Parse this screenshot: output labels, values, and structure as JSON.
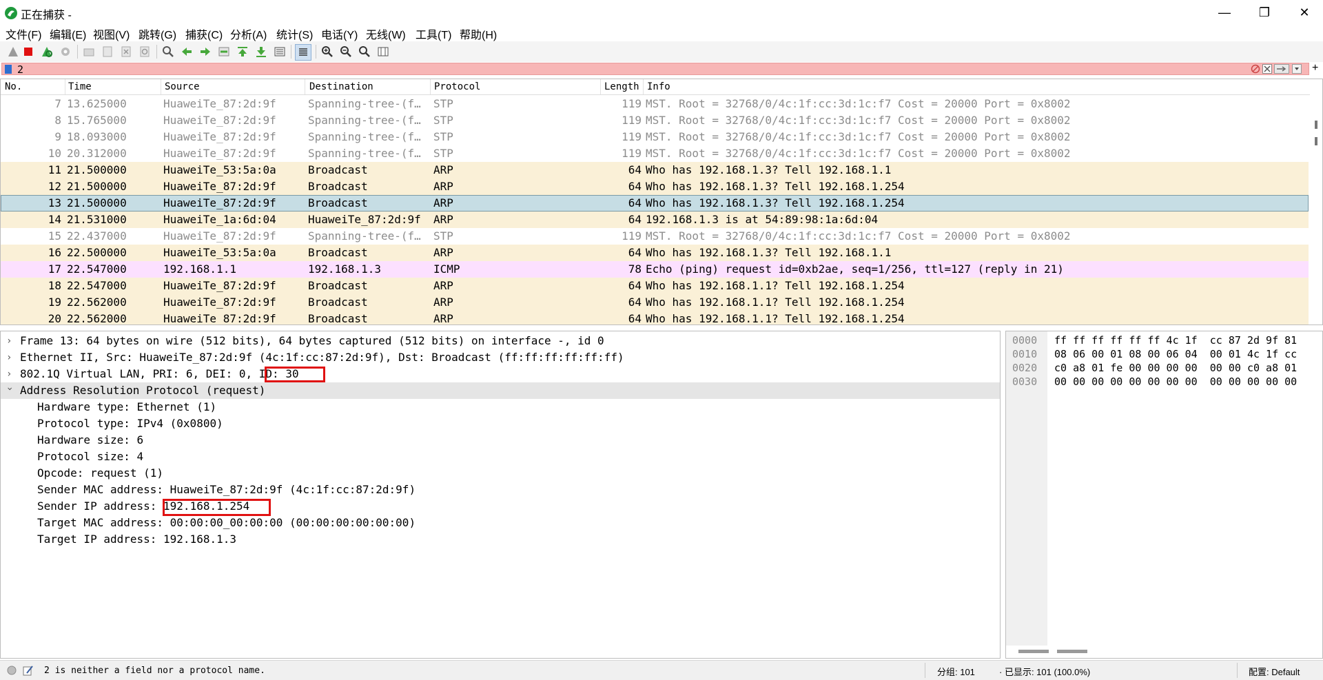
{
  "window": {
    "title": "正在捕获 -",
    "buttons": {
      "minimize": "—",
      "maximize": "❐",
      "close": "✕"
    }
  },
  "menu": [
    "文件(F)",
    "编辑(E)",
    "视图(V)",
    "跳转(G)",
    "捕获(C)",
    "分析(A)",
    "统计(S)",
    "电话(Y)",
    "无线(W)",
    "工具(T)",
    "帮助(H)"
  ],
  "toolbar_icons": [
    "shark-fin-start-icon",
    "stop-capture-icon",
    "restart-capture-icon",
    "capture-options-icon",
    "open-file-icon",
    "save-file-icon",
    "close-file-icon",
    "reload-file-icon",
    "find-packet-icon",
    "go-back-icon",
    "go-forward-icon",
    "go-to-packet-icon",
    "go-first-icon",
    "go-last-icon",
    "auto-scroll-icon",
    "colorize-icon",
    "zoom-in-icon",
    "zoom-out-icon",
    "zoom-normal-icon",
    "resize-columns-icon"
  ],
  "filter": {
    "value": "2",
    "color": "#f7b6b6"
  },
  "packet_list": {
    "columns": [
      "No.",
      "Time",
      "Source",
      "Destination",
      "Protocol",
      "Length",
      "Info"
    ],
    "rows": [
      {
        "no": "7",
        "time": "13.625000",
        "src": "HuaweiTe_87:2d:9f",
        "dst": "Spanning-tree-(f…",
        "proto": "STP",
        "len": "119",
        "info": "MST. Root = 32768/0/4c:1f:cc:3d:1c:f7  Cost = 20000  Port = 0x8002",
        "style": "stp"
      },
      {
        "no": "8",
        "time": "15.765000",
        "src": "HuaweiTe_87:2d:9f",
        "dst": "Spanning-tree-(f…",
        "proto": "STP",
        "len": "119",
        "info": "MST. Root = 32768/0/4c:1f:cc:3d:1c:f7  Cost = 20000  Port = 0x8002",
        "style": "stp"
      },
      {
        "no": "9",
        "time": "18.093000",
        "src": "HuaweiTe_87:2d:9f",
        "dst": "Spanning-tree-(f…",
        "proto": "STP",
        "len": "119",
        "info": "MST. Root = 32768/0/4c:1f:cc:3d:1c:f7  Cost = 20000  Port = 0x8002",
        "style": "stp"
      },
      {
        "no": "10",
        "time": "20.312000",
        "src": "HuaweiTe_87:2d:9f",
        "dst": "Spanning-tree-(f…",
        "proto": "STP",
        "len": "119",
        "info": "MST. Root = 32768/0/4c:1f:cc:3d:1c:f7  Cost = 20000  Port = 0x8002",
        "style": "stp"
      },
      {
        "no": "11",
        "time": "21.500000",
        "src": "HuaweiTe_53:5a:0a",
        "dst": "Broadcast",
        "proto": "ARP",
        "len": "64",
        "info": "Who has 192.168.1.3? Tell 192.168.1.1",
        "style": "arp"
      },
      {
        "no": "12",
        "time": "21.500000",
        "src": "HuaweiTe_87:2d:9f",
        "dst": "Broadcast",
        "proto": "ARP",
        "len": "64",
        "info": "Who has 192.168.1.3? Tell 192.168.1.254",
        "style": "arp"
      },
      {
        "no": "13",
        "time": "21.500000",
        "src": "HuaweiTe_87:2d:9f",
        "dst": "Broadcast",
        "proto": "ARP",
        "len": "64",
        "info": "Who has 192.168.1.3? Tell 192.168.1.254",
        "style": "selected"
      },
      {
        "no": "14",
        "time": "21.531000",
        "src": "HuaweiTe_1a:6d:04",
        "dst": "HuaweiTe_87:2d:9f",
        "proto": "ARP",
        "len": "64",
        "info": "192.168.1.3 is at 54:89:98:1a:6d:04",
        "style": "arp"
      },
      {
        "no": "15",
        "time": "22.437000",
        "src": "HuaweiTe_87:2d:9f",
        "dst": "Spanning-tree-(f…",
        "proto": "STP",
        "len": "119",
        "info": "MST. Root = 32768/0/4c:1f:cc:3d:1c:f7  Cost = 20000  Port = 0x8002",
        "style": "stp"
      },
      {
        "no": "16",
        "time": "22.500000",
        "src": "HuaweiTe_53:5a:0a",
        "dst": "Broadcast",
        "proto": "ARP",
        "len": "64",
        "info": "Who has 192.168.1.3? Tell 192.168.1.1",
        "style": "arp"
      },
      {
        "no": "17",
        "time": "22.547000",
        "src": "192.168.1.1",
        "dst": "192.168.1.3",
        "proto": "ICMP",
        "len": "78",
        "info": "Echo (ping) request  id=0xb2ae, seq=1/256, ttl=127 (reply in 21)",
        "style": "icmp"
      },
      {
        "no": "18",
        "time": "22.547000",
        "src": "HuaweiTe_87:2d:9f",
        "dst": "Broadcast",
        "proto": "ARP",
        "len": "64",
        "info": "Who has 192.168.1.1? Tell 192.168.1.254",
        "style": "arp"
      },
      {
        "no": "19",
        "time": "22.562000",
        "src": "HuaweiTe_87:2d:9f",
        "dst": "Broadcast",
        "proto": "ARP",
        "len": "64",
        "info": "Who has 192.168.1.1? Tell 192.168.1.254",
        "style": "arp"
      },
      {
        "no": "20",
        "time": "22.562000",
        "src": "HuaweiTe_87:2d:9f",
        "dst": "Broadcast",
        "proto": "ARP",
        "len": "64",
        "info": "Who has 192.168.1.1? Tell 192.168.1.254",
        "style": "arp"
      }
    ],
    "row_colors": {
      "stp": "#ffffff",
      "arp": "#faf0d7",
      "selected": "#c6dde4",
      "icmp": "#fce0ff"
    },
    "stp_text_color": "#8c8c8c"
  },
  "details": {
    "frame": "Frame 13: 64 bytes on wire (512 bits), 64 bytes captured (512 bits) on interface -, id 0",
    "ethernet": "Ethernet II, Src: HuaweiTe_87:2d:9f (4c:1f:cc:87:2d:9f), Dst: Broadcast (ff:ff:ff:ff:ff:ff)",
    "vlan_prefix": "802.1Q Virtual LAN, PRI: 6, DEI: 0, ",
    "vlan_id": "ID: 30",
    "arp": "Address Resolution Protocol (request)",
    "arp_fields": {
      "hw_type": "Hardware type: Ethernet (1)",
      "proto_type": "Protocol type: IPv4 (0x0800)",
      "hw_size": "Hardware size: 6",
      "proto_size": "Protocol size: 4",
      "opcode": "Opcode: request (1)",
      "sender_mac": "Sender MAC address: HuaweiTe_87:2d:9f (4c:1f:cc:87:2d:9f)",
      "sender_ip_label": "Sender IP address: ",
      "sender_ip": "192.168.1.254",
      "target_mac": "Target MAC address: 00:00:00_00:00:00 (00:00:00:00:00:00)",
      "target_ip": "Target IP address: 192.168.1.3"
    },
    "selected_row_color": "#e5e5e5",
    "highlight_color": "#e01212"
  },
  "hex": {
    "offsets": [
      "0000",
      "0010",
      "0020",
      "0030"
    ],
    "lines": [
      "ff ff ff ff ff ff 4c 1f  cc 87 2d 9f 81",
      "08 06 00 01 08 00 06 04  00 01 4c 1f cc",
      "c0 a8 01 fe 00 00 00 00  00 00 c0 a8 01",
      "00 00 00 00 00 00 00 00  00 00 00 00 00"
    ]
  },
  "status": {
    "message": "2 is neither a field nor a protocol name.",
    "packets": "分组: 101",
    "displayed": "· 已显示: 101 (100.0%)",
    "profile": "配置: Default"
  }
}
